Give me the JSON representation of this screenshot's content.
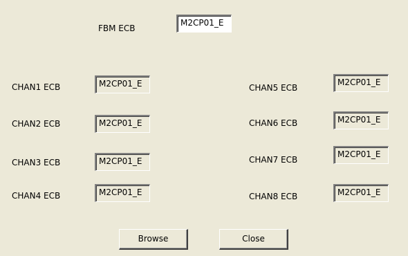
{
  "fbm": {
    "label": "FBM ECB",
    "value": "M2CP01_E"
  },
  "channels_left": [
    {
      "label": "CHAN1 ECB",
      "value": "M2CP01_E"
    },
    {
      "label": "CHAN2 ECB",
      "value": "M2CP01_E"
    },
    {
      "label": "CHAN3 ECB",
      "value": "M2CP01_E"
    },
    {
      "label": "CHAN4 ECB",
      "value": "M2CP01_E"
    }
  ],
  "channels_right": [
    {
      "label": "CHAN5 ECB",
      "value": "M2CP01_E"
    },
    {
      "label": "CHAN6 ECB",
      "value": "M2CP01_E"
    },
    {
      "label": "CHAN7 ECB",
      "value": "M2CP01_E"
    },
    {
      "label": "CHAN8 ECB",
      "value": "M2CP01_E"
    }
  ],
  "buttons": {
    "browse_label": "Browse",
    "close_label": "Close"
  },
  "colors": {
    "dialog_background": "#ECE9D8",
    "field_background": "#FFFFFF",
    "text": "#000000"
  }
}
